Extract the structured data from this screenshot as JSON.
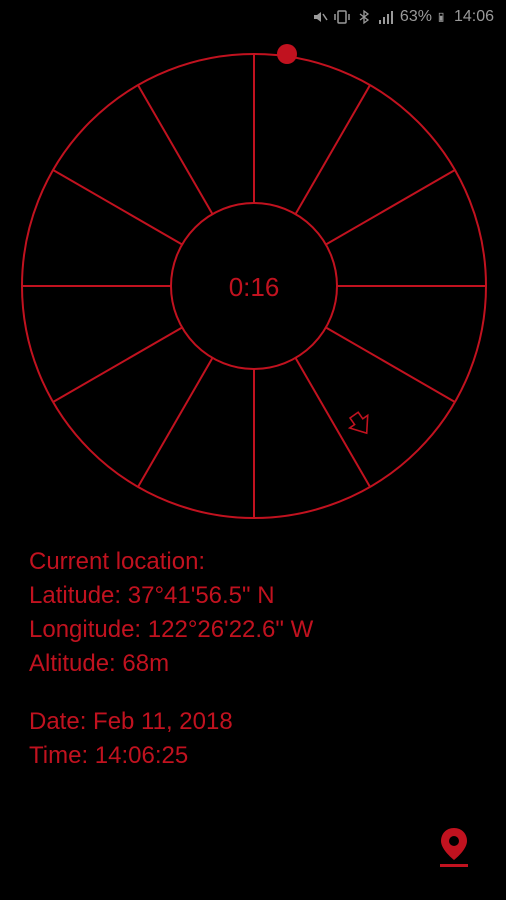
{
  "colors": {
    "accent": "#c1121f",
    "background": "#000000",
    "status": "#9a9a9a"
  },
  "status_bar": {
    "battery": "63%",
    "time": "14:06",
    "icons": [
      "mute-icon",
      "vibrate-icon",
      "bluetooth-icon",
      "signal-icon",
      "battery-icon"
    ]
  },
  "dial": {
    "timer": "0:16",
    "segments": 12
  },
  "info": {
    "heading": "Current location:",
    "latitude": "Latitude: 37°41'56.5\" N",
    "longitude": "Longitude: 122°26'22.6\" W",
    "altitude": "Altitude: 68m",
    "date": "Date: Feb 11, 2018",
    "time": "Time: 14:06:25"
  },
  "icons": {
    "pin": "location-pin-icon",
    "pointer": "pointer-hand-icon"
  }
}
